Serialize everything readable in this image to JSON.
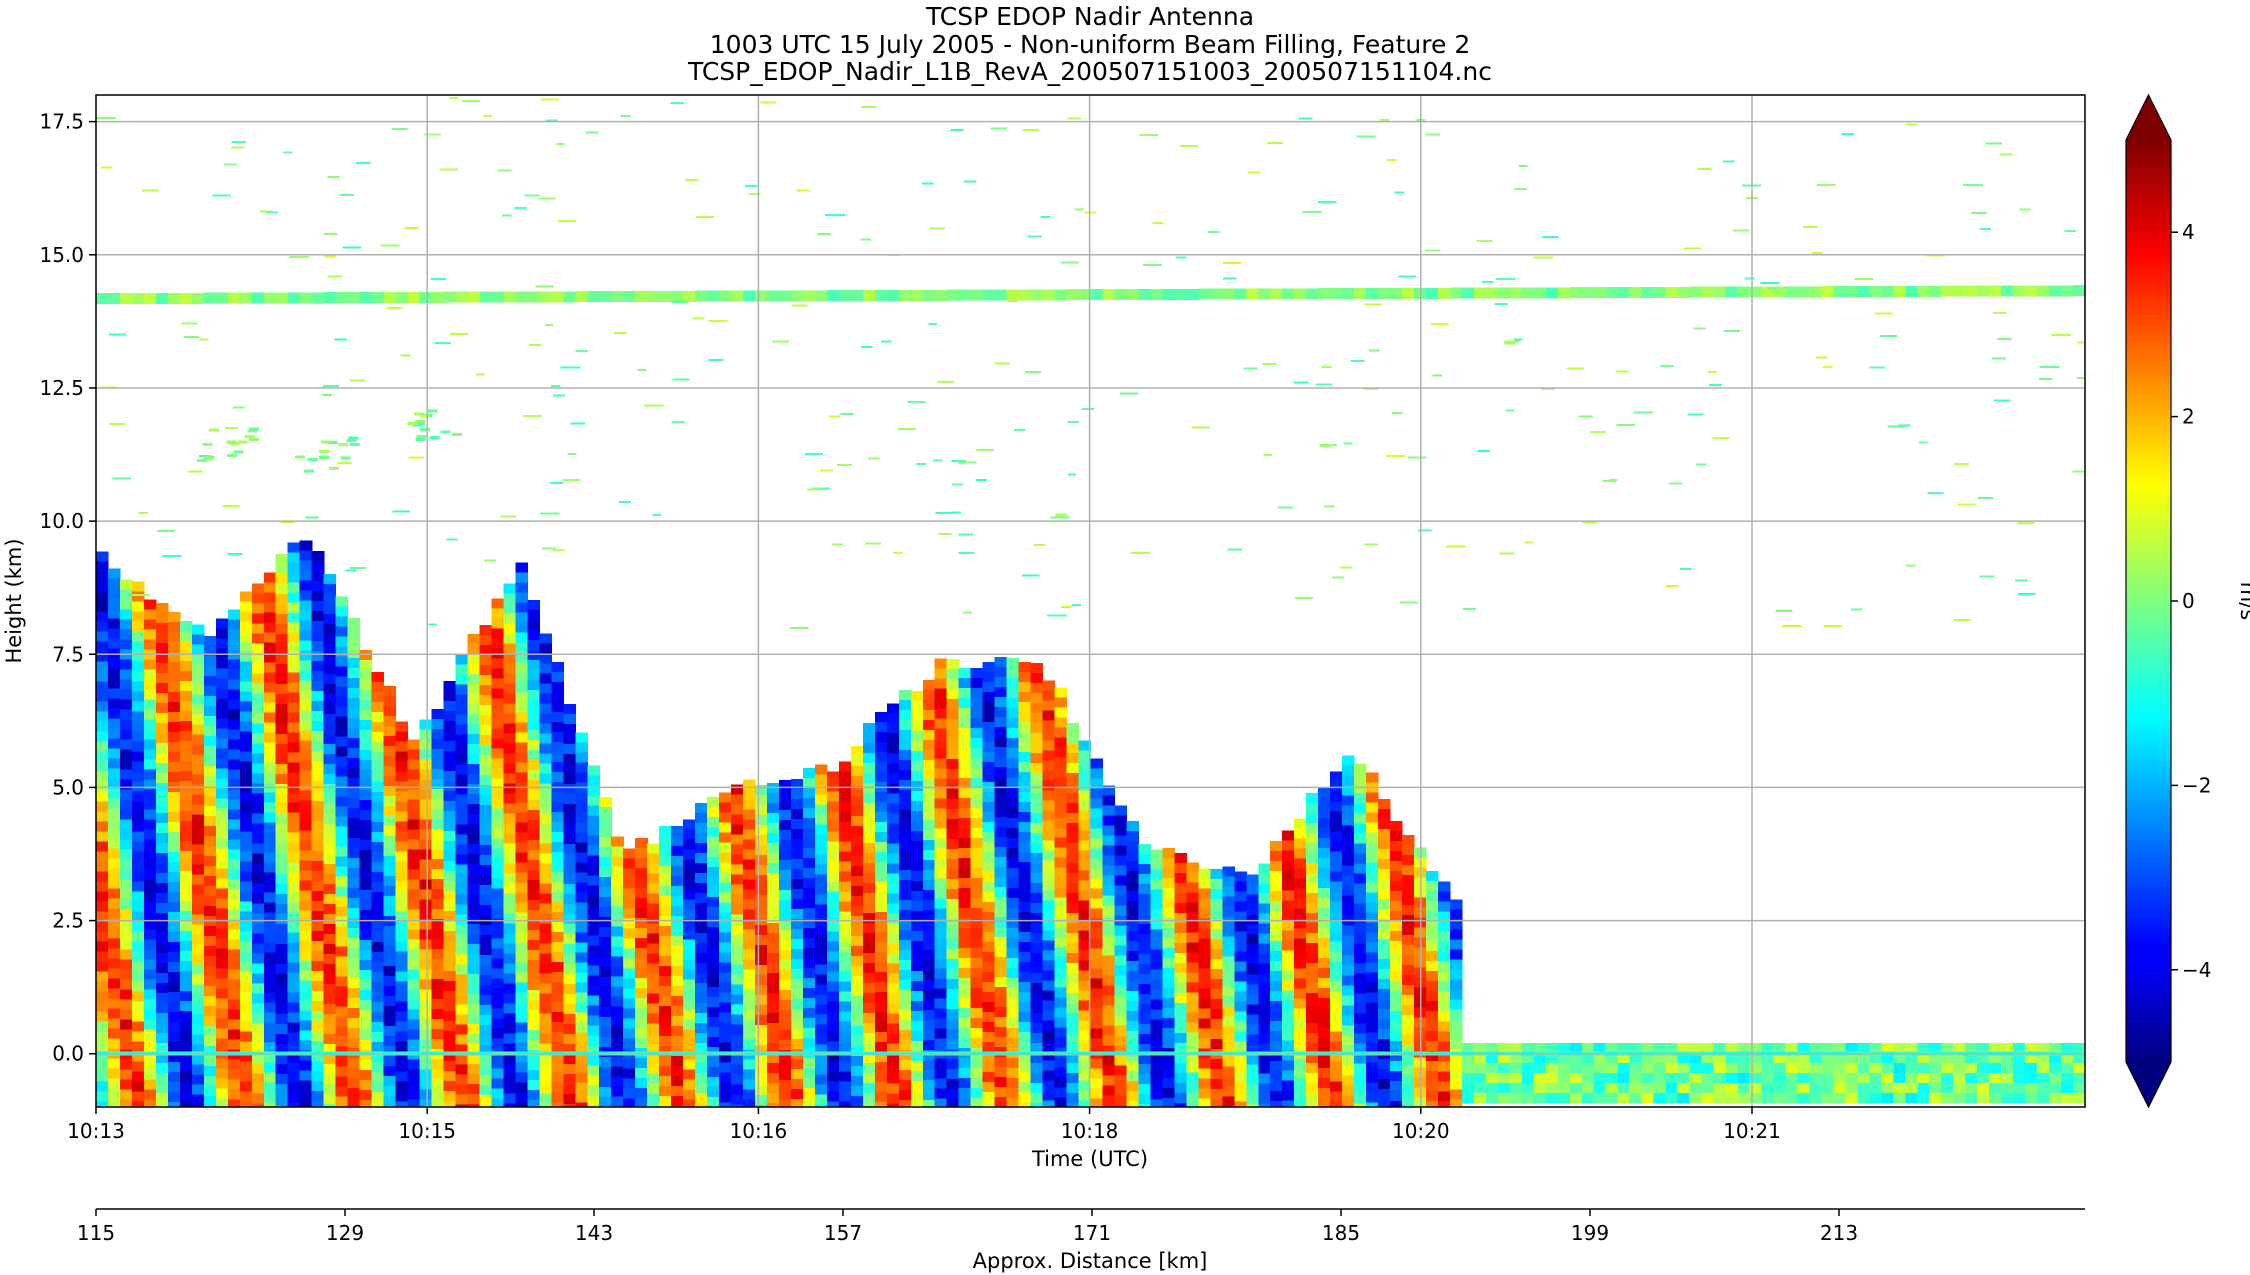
{
  "chart_data": {
    "type": "heatmap",
    "title_lines": [
      "TCSP EDOP Nadir Antenna",
      "1003 UTC 15 July 2005 - Non-uniform Beam Filling, Feature 2",
      "TCSP_EDOP_Nadir_L1B_RevA_200507151003_200507151104.nc"
    ],
    "xlabel": "Time (UTC)",
    "ylabel": "Height (km)",
    "x_ticks": [
      "10:13",
      "10:15",
      "10:16",
      "10:18",
      "10:20",
      "10:21"
    ],
    "y_ticks": [
      0.0,
      2.5,
      5.0,
      7.5,
      10.0,
      12.5,
      15.0,
      17.5
    ],
    "y_tick_labels": [
      "0.0",
      "2.5",
      "5.0",
      "7.5",
      "10.0",
      "12.5",
      "15.0",
      "17.5"
    ],
    "ylim": [
      -1.0,
      18.0
    ],
    "grid": true,
    "secondary_xlabel": "Approx. Distance [km]",
    "secondary_x_ticks": [
      115,
      129,
      143,
      157,
      171,
      185,
      199,
      213
    ],
    "colorbar": {
      "label": "m/s",
      "colormap": "jet",
      "vmin": -5,
      "vmax": 5,
      "extend": "both",
      "ticks": [
        -4,
        -2,
        0,
        2,
        4
      ],
      "tick_labels": [
        "−4",
        "−2",
        "0",
        "2",
        "4"
      ]
    },
    "features": {
      "tropopause_layer_height_km": 14.2,
      "surface_height_km": 0.0,
      "cloud_tops_km": [
        9.3,
        7.8,
        9.8,
        5.8,
        9.3,
        3.7,
        5.0,
        5.4,
        7.3,
        7.4,
        3.9,
        3.4,
        5.7,
        2.7
      ],
      "convective_region_end_time": "10:20"
    }
  }
}
